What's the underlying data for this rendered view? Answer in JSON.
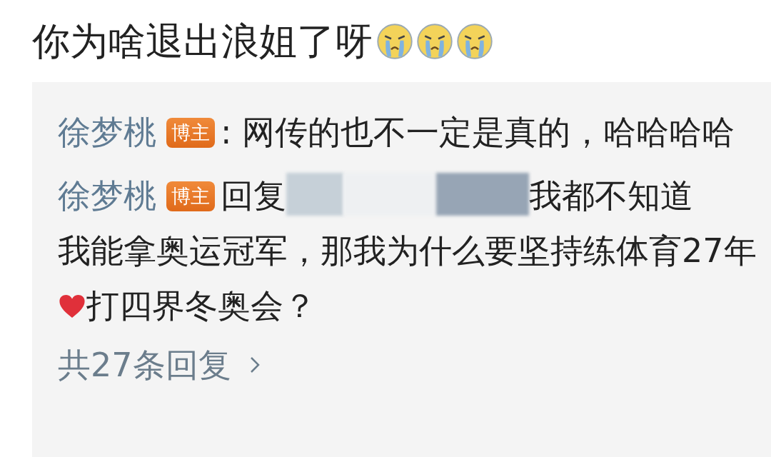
{
  "post": {
    "text": "你为啥退出浪姐了呀",
    "emojis": [
      {
        "kind": "crying"
      },
      {
        "kind": "crying"
      },
      {
        "kind": "crying"
      }
    ]
  },
  "replies": [
    {
      "author": "徐梦桃",
      "badge": "博主",
      "segments": [
        {
          "kind": "text",
          "text": ": 网传的也不一定是真的，哈哈"
        },
        {
          "kind": "text",
          "text": "哈哈"
        }
      ]
    },
    {
      "author": "徐梦桃",
      "badge": "博主",
      "segments": [
        {
          "kind": "text",
          "text": "回复"
        },
        {
          "kind": "redacted"
        },
        {
          "kind": "text",
          "text": "我都不知道"
        },
        {
          "kind": "text",
          "text": "我能拿奥运冠军，那我为什么要坚持练体育"
        },
        {
          "kind": "text",
          "text": "27年"
        },
        {
          "kind": "heart"
        },
        {
          "kind": "text",
          "text": "打四界冬奥会？"
        }
      ]
    }
  ],
  "more_replies": {
    "label": "共27条回复"
  }
}
